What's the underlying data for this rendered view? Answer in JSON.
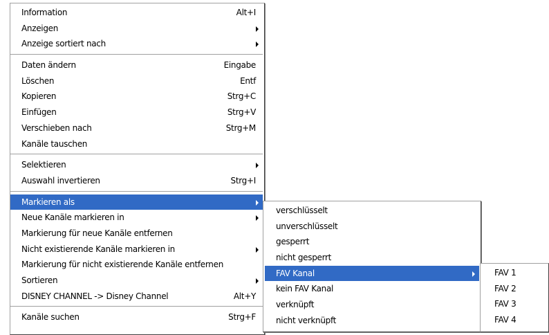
{
  "main_menu": {
    "items": [
      {
        "label": "Information",
        "shortcut": "Alt+I"
      },
      {
        "label": "Anzeigen",
        "submenu": true
      },
      {
        "label": "Anzeige sortiert nach",
        "submenu": true
      },
      {
        "label": "Daten ändern",
        "shortcut": "Eingabe"
      },
      {
        "label": "Löschen",
        "shortcut": "Entf"
      },
      {
        "label": "Kopieren",
        "shortcut": "Strg+C"
      },
      {
        "label": "Einfügen",
        "shortcut": "Strg+V"
      },
      {
        "label": "Verschieben nach",
        "shortcut": "Strg+M"
      },
      {
        "label": "Kanäle tauschen"
      },
      {
        "label": "Selektieren",
        "submenu": true
      },
      {
        "label": "Auswahl invertieren",
        "shortcut": "Strg+I"
      },
      {
        "label": "Markieren als",
        "submenu": true,
        "selected": true
      },
      {
        "label": "Neue Kanäle markieren in",
        "submenu": true
      },
      {
        "label": "Markierung für neue Kanäle entfernen"
      },
      {
        "label": "Nicht existierende Kanäle markieren in",
        "submenu": true
      },
      {
        "label": "Markierung für nicht existierende Kanäle entfernen"
      },
      {
        "label": "Sortieren",
        "submenu": true
      },
      {
        "label": "DISNEY CHANNEL -> Disney Channel",
        "shortcut": "Alt+Y"
      },
      {
        "label": "Kanäle suchen",
        "shortcut": "Strg+F"
      }
    ]
  },
  "markieren_submenu": {
    "items": [
      {
        "label": "verschlüsselt"
      },
      {
        "label": "unverschlüsselt"
      },
      {
        "label": "gesperrt"
      },
      {
        "label": "nicht gesperrt"
      },
      {
        "label": "FAV Kanal",
        "submenu": true,
        "selected": true
      },
      {
        "label": "kein FAV Kanal"
      },
      {
        "label": "verknüpft"
      },
      {
        "label": "nicht verknüpft"
      }
    ]
  },
  "fav_submenu": {
    "items": [
      {
        "label": "FAV 1"
      },
      {
        "label": "FAV 2"
      },
      {
        "label": "FAV 3"
      },
      {
        "label": "FAV 4"
      }
    ]
  },
  "colors": {
    "highlight": "#316ac5",
    "highlight_text": "#ffffff",
    "menu_bg": "#ffffff"
  }
}
